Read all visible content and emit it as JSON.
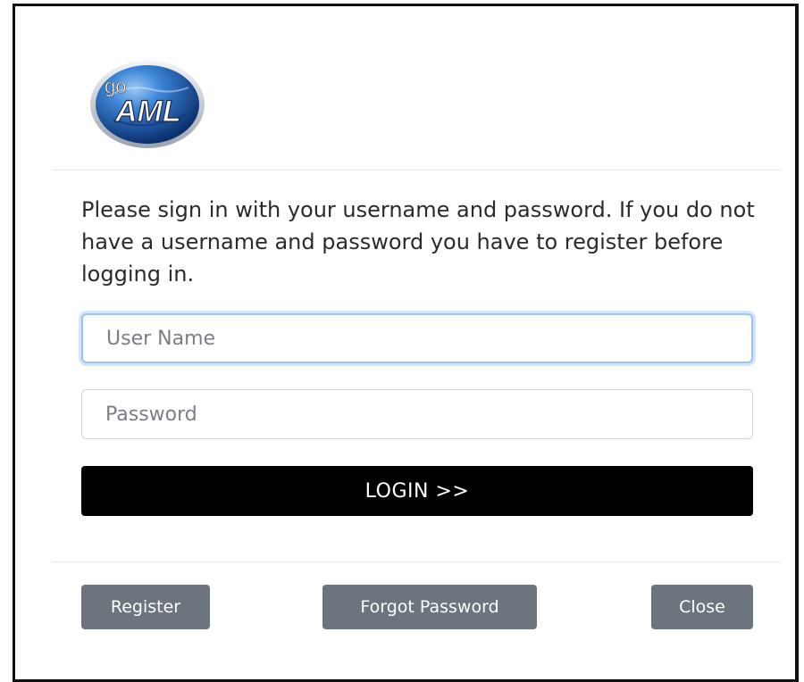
{
  "logo": {
    "prefix": "go",
    "name": "AML",
    "colors": {
      "globe_dark": "#0b2f6e",
      "globe_light": "#3d86d8",
      "ring": "#c9ced6"
    }
  },
  "intro_text": "Please sign in with your username and password. If you do not have a username and password you have to register before logging in.",
  "form": {
    "username": {
      "placeholder": "User Name",
      "value": ""
    },
    "password": {
      "placeholder": "Password",
      "value": ""
    },
    "login_label": "LOGIN >>"
  },
  "footer": {
    "register_label": "Register",
    "forgot_label": "Forgot Password",
    "close_label": "Close"
  },
  "colors": {
    "login_bg": "#000000",
    "secondary_btn": "#6c757d",
    "focus_border": "#9cc3f5"
  }
}
